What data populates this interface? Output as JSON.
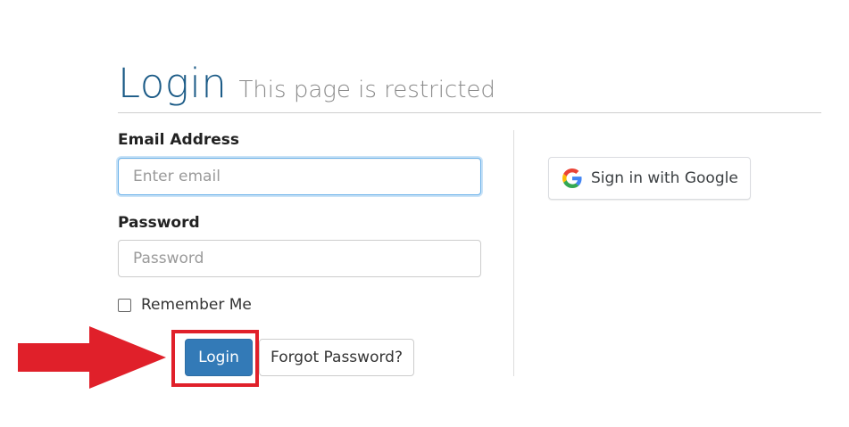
{
  "header": {
    "title": "Login",
    "subtitle": "This page is restricted"
  },
  "form": {
    "email": {
      "label": "Email Address",
      "placeholder": "Enter email",
      "value": ""
    },
    "password": {
      "label": "Password",
      "placeholder": "Password",
      "value": ""
    },
    "remember": {
      "label": "Remember Me",
      "checked": false
    },
    "login_label": "Login",
    "forgot_label": "Forgot Password?"
  },
  "social": {
    "google_label": "Sign in with Google"
  },
  "annotation": {
    "arrow_color": "#e0202a",
    "highlight_color": "#e0202a"
  },
  "colors": {
    "title": "#1a5a86",
    "primary": "#337ab7",
    "focus_ring": "#66afe9"
  }
}
